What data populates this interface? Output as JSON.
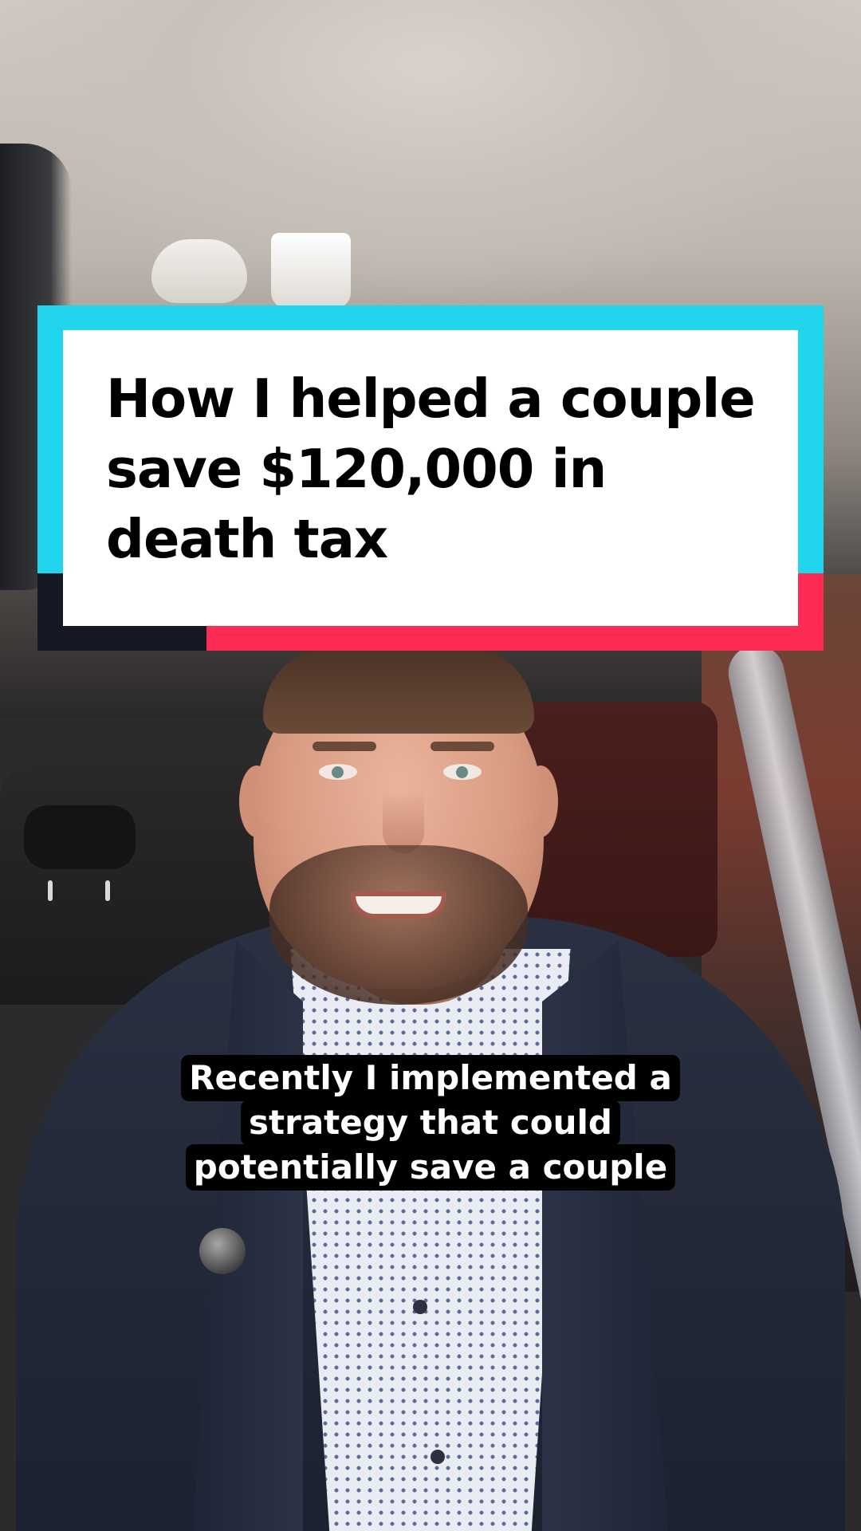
{
  "video": {
    "title_card": {
      "text": "How I helped a couple save $120,000 in death tax"
    },
    "captions": [
      "Recently I implemented a",
      "strategy that could",
      "potentially save a couple"
    ]
  },
  "colors": {
    "frame_cyan": "#20d5ec",
    "frame_pink": "#fe2c55",
    "frame_dark": "#161823",
    "card_bg": "#ffffff",
    "caption_bg": "#000000",
    "caption_text": "#ffffff"
  }
}
